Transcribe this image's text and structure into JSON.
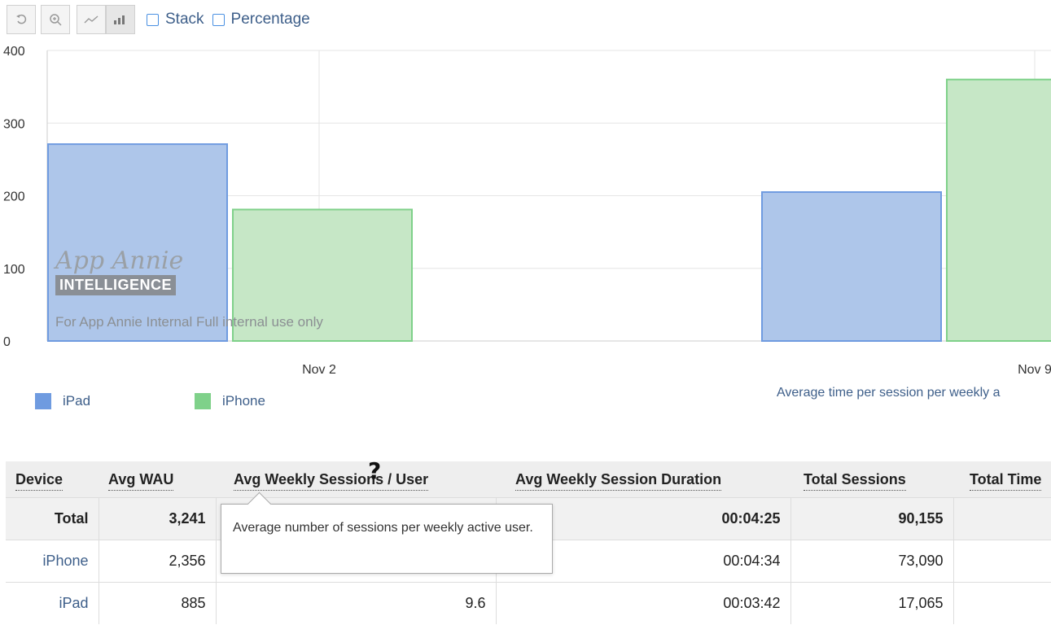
{
  "toolbar": {
    "reset_icon": "undo-icon",
    "zoom_icon": "zoom-in-icon",
    "line_icon": "line-chart-icon",
    "bar_icon": "bar-chart-icon",
    "stack_label": "Stack",
    "percentage_label": "Percentage"
  },
  "watermark": {
    "logo": "App Annie",
    "badge": "INTELLIGENCE",
    "note": "For App Annie Internal Full internal use only"
  },
  "legend": {
    "ipad": "iPad",
    "iphone": "iPhone"
  },
  "chart_subtitle": "Average time per session per weekly a",
  "chart_data": {
    "type": "bar",
    "categories": [
      "Nov 2",
      "Nov 9"
    ],
    "series": [
      {
        "name": "iPad",
        "values": [
          271,
          205
        ],
        "color": "#aec6ea",
        "stroke": "#6f9be0"
      },
      {
        "name": "iPhone",
        "values": [
          181,
          360
        ],
        "color": "#c6e7c6",
        "stroke": "#7fd18a"
      }
    ],
    "ylim": [
      0,
      400
    ],
    "yticks": [
      "0",
      "100",
      "200",
      "300",
      "400"
    ],
    "grid": true,
    "legend": "bottom-left"
  },
  "table": {
    "headers": [
      "Device",
      "Avg WAU",
      "Avg Weekly Sessions / User",
      "Avg Weekly Session Duration",
      "Total Sessions",
      "Total Time"
    ],
    "rows": [
      {
        "device": "Total",
        "wau": "3,241",
        "sessions_per_user": "",
        "duration": "00:04:25",
        "total_sessions": "90,155"
      },
      {
        "device": "iPhone",
        "wau": "2,356",
        "sessions_per_user": "",
        "duration": "00:04:34",
        "total_sessions": "73,090"
      },
      {
        "device": "iPad",
        "wau": "885",
        "sessions_per_user": "9.6",
        "duration": "00:03:42",
        "total_sessions": "17,065"
      }
    ]
  },
  "tooltip": {
    "text": "Average number of sessions per weekly active user."
  }
}
